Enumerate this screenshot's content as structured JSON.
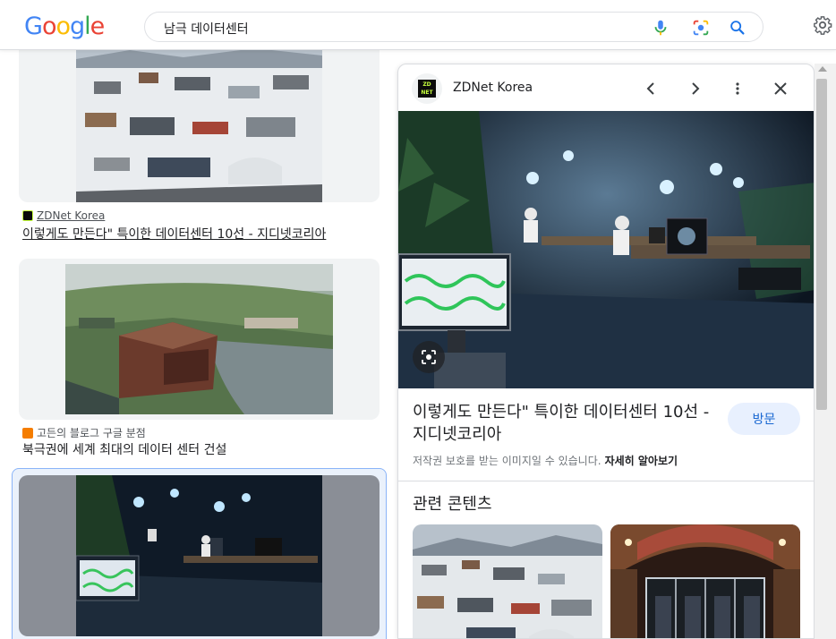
{
  "header": {
    "logo": "Google",
    "search_query": "남극 데이터센터",
    "icons": [
      "mic-icon",
      "camera-lens-icon",
      "search-icon",
      "gear-icon"
    ]
  },
  "results": [
    {
      "source": "ZDNet Korea",
      "title": "이렇게도 만든다\" 특이한 데이터센터 10선 - 지디넷코리아",
      "image_desc_icon": "antarctic-base-image"
    },
    {
      "source": "고든의 블로그 구글 분점",
      "title": "북극권에 세계 최대의 데이터 센터 건설",
      "image_desc_icon": "arctic-datacenter-image"
    },
    {
      "image_desc_icon": "underground-control-room-image"
    }
  ],
  "panel": {
    "source_name": "ZDNet Korea",
    "avatar_text": "ZD NET",
    "title": "이렇게도 만든다\" 특이한 데이터센터 10선 - 지디넷코리아",
    "visit_label": "방문",
    "copyright_text": "저작권 보호를 받는 이미지일 수 있습니다.",
    "learn_more_label": "자세히 알아보기",
    "related_heading": "관련 콘텐츠"
  },
  "colors": {
    "google_blue": "#4285F4",
    "google_red": "#EA4335",
    "google_yellow": "#FBBC05",
    "google_green": "#34A853",
    "link_blue": "#1967d2",
    "visit_bg": "#e8f0fe"
  }
}
